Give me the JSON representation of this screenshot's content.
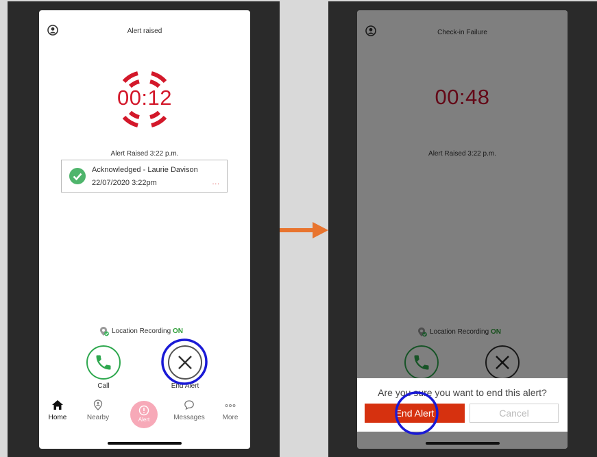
{
  "left_screen": {
    "title": "Alert raised",
    "timer": "00:12",
    "alert_raised_text": "Alert Raised 3:22 p.m.",
    "acknowledgement": {
      "line1": "Acknowledged - Laurie Davison",
      "line2": "22/07/2020 3:22pm",
      "more": "..."
    },
    "location": {
      "label": "Location Recording",
      "status": "ON"
    },
    "call_label": "Call",
    "end_alert_label": "End Alert",
    "nav": [
      {
        "label": "Home"
      },
      {
        "label": "Nearby"
      },
      {
        "label": "Alert"
      },
      {
        "label": "Messages"
      },
      {
        "label": "More"
      }
    ]
  },
  "right_screen": {
    "title": "Check-in Failure",
    "timer": "00:48",
    "alert_raised_text": "Alert Raised 3:22 p.m.",
    "location": {
      "label": "Location Recording",
      "status": "ON"
    },
    "dialog": {
      "message": "Are you sure you want to end this alert?",
      "confirm_label": "End Alert",
      "cancel_label": "Cancel"
    }
  },
  "colors": {
    "accent_red": "#d3182a",
    "green": "#2e9e38",
    "highlight_ring": "#1a1ad6",
    "arrow": "#e8742e"
  }
}
